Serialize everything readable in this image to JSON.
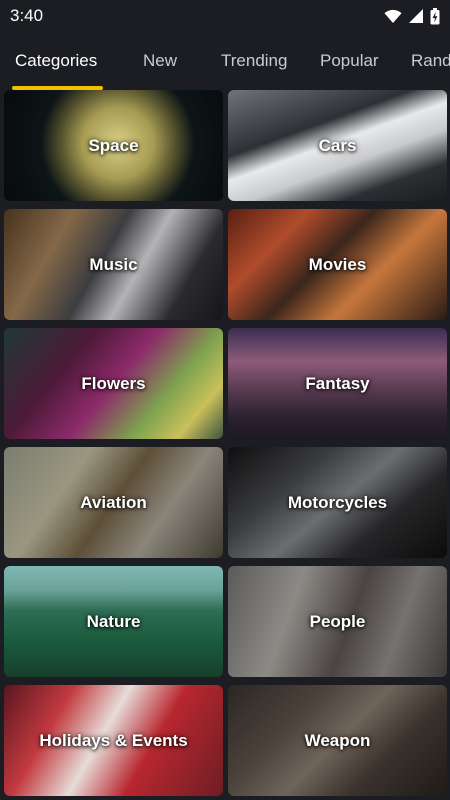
{
  "status_bar": {
    "time": "3:40",
    "icons": [
      "wifi-icon",
      "signal-icon",
      "battery-charging-icon"
    ]
  },
  "tabs": [
    {
      "label": "Categories",
      "active": true
    },
    {
      "label": "New",
      "active": false
    },
    {
      "label": "Trending",
      "active": false
    },
    {
      "label": "Popular",
      "active": false
    },
    {
      "label": "Rand",
      "active": false
    }
  ],
  "colors": {
    "background": "#1c1d22",
    "accent": "#f2c200",
    "tab_inactive": "#c9cbd1",
    "text": "#ffffff"
  },
  "categories": [
    {
      "label": "Space"
    },
    {
      "label": "Cars"
    },
    {
      "label": "Music"
    },
    {
      "label": "Movies"
    },
    {
      "label": "Flowers"
    },
    {
      "label": "Fantasy"
    },
    {
      "label": "Aviation"
    },
    {
      "label": "Motorcycles"
    },
    {
      "label": "Nature"
    },
    {
      "label": "People"
    },
    {
      "label": "Holidays & Events"
    },
    {
      "label": "Weapon"
    }
  ]
}
